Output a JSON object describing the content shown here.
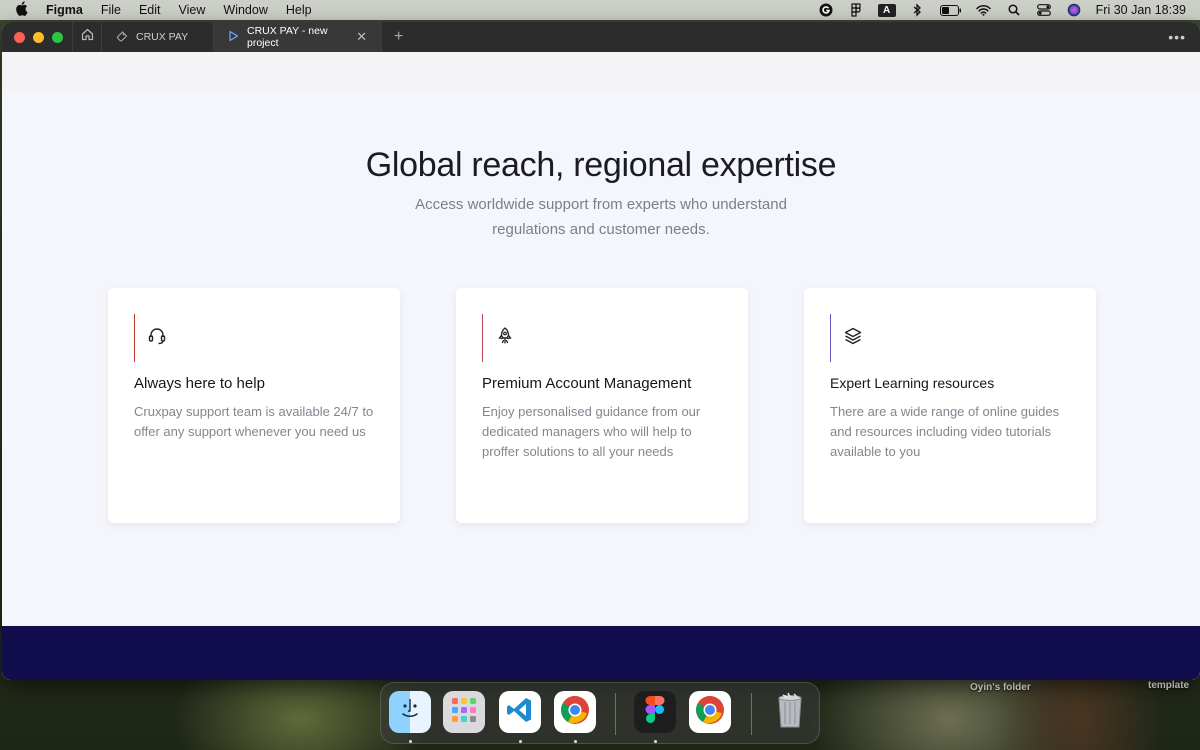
{
  "menubar": {
    "app_name": "Figma",
    "menus": [
      "File",
      "Edit",
      "View",
      "Window",
      "Help"
    ],
    "input_badge": "A",
    "clock": "Fri 30 Jan  18:39"
  },
  "window": {
    "tabs": [
      {
        "label": "CRUX PAY",
        "icon": "figma-file-icon"
      },
      {
        "label": "CRUX PAY - new project",
        "icon": "play-icon"
      }
    ]
  },
  "page": {
    "heading": "Global reach, regional expertise",
    "subheading": "Access worldwide support from experts who understand regulations and customer needs.",
    "cards": [
      {
        "icon": "headset-icon",
        "accent": "#c0392b",
        "title": "Always here to help",
        "body": "Cruxpay support team is available 24/7 to offer any support whenever you need us"
      },
      {
        "icon": "rocket-icon",
        "accent": "#b5454f",
        "title": "Premium Account Management",
        "body": "Enjoy personalised guidance from our dedicated managers who will help to proffer solutions to all your needs"
      },
      {
        "icon": "layers-icon",
        "accent": "#6a4fc4",
        "title": "Expert Learning resources",
        "body": "There are a wide range of online guides and resources including video tutorials available to you"
      }
    ],
    "footer_color": "#120e4d"
  },
  "desktop": {
    "labels": [
      "Oyin's folder",
      "template"
    ]
  },
  "dock": {
    "apps": [
      "Finder",
      "Launchpad",
      "Visual Studio Code",
      "Google Chrome",
      "Figma",
      "Google Chrome",
      "Trash"
    ]
  }
}
